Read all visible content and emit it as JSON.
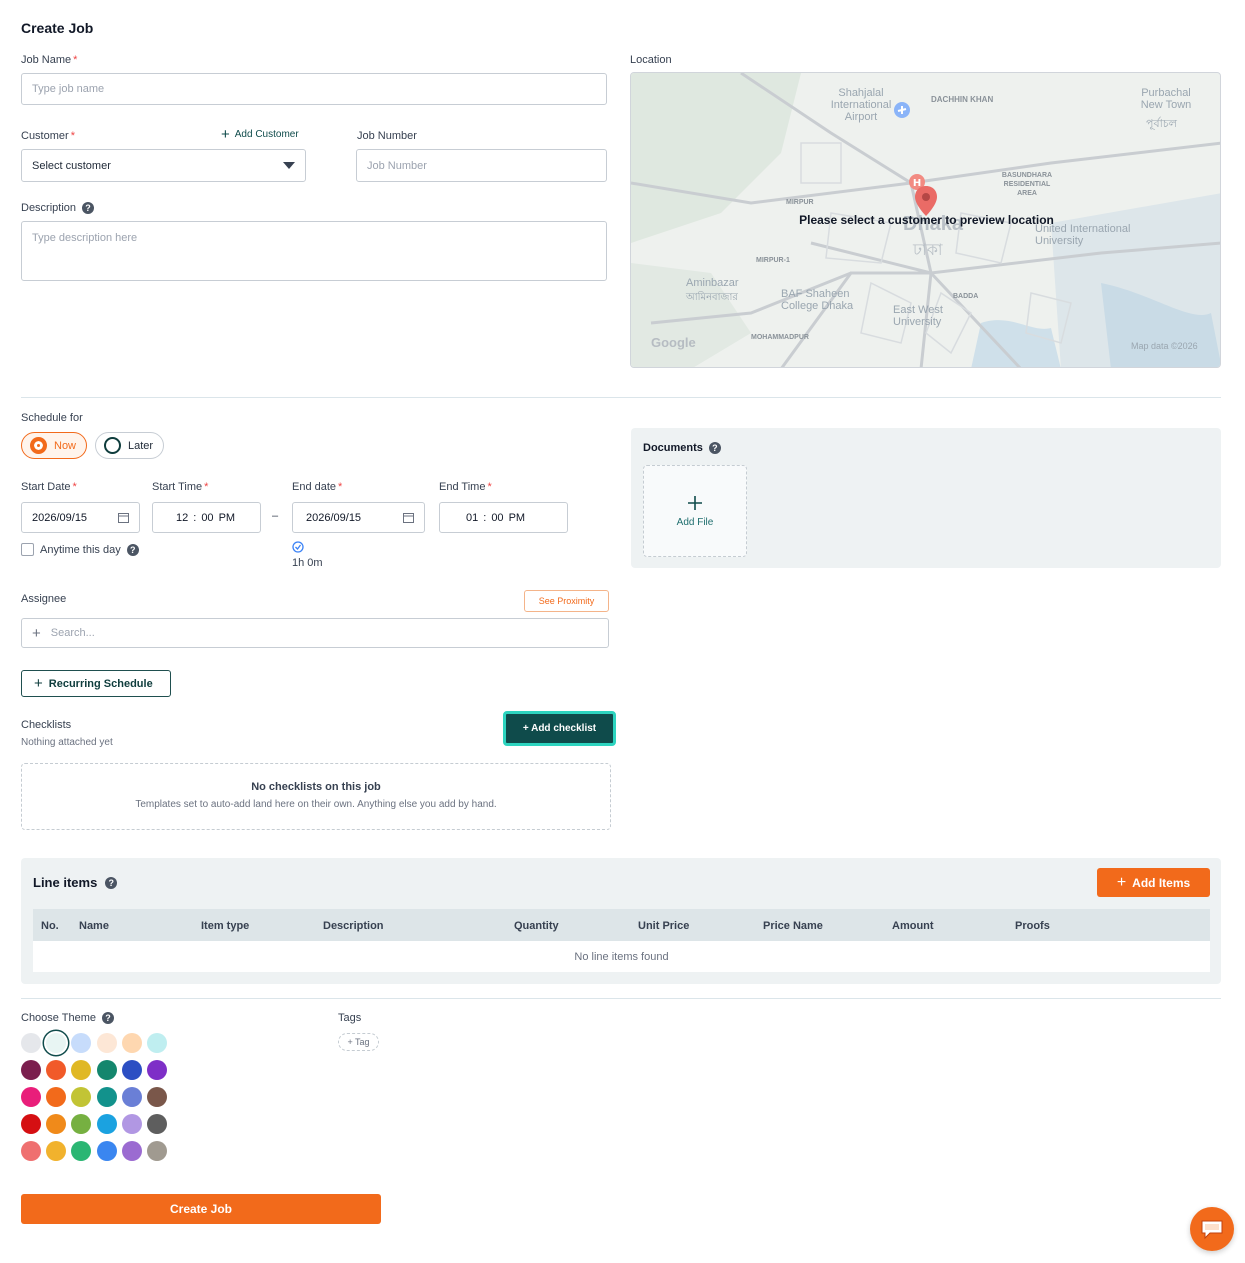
{
  "page": {
    "title": "Create Job"
  },
  "job_name": {
    "label": "Job Name",
    "placeholder": "Type job name"
  },
  "customer": {
    "label": "Customer",
    "add_label": "Add Customer",
    "selected": "Select customer"
  },
  "job_number": {
    "label": "Job Number",
    "placeholder": "Job Number"
  },
  "description": {
    "label": "Description",
    "placeholder": "Type description here"
  },
  "location": {
    "label": "Location",
    "overlay": "Please select a customer to preview location",
    "attribution": "Map data ©2026",
    "logo": "Google",
    "places": {
      "airport": "Shahjalal International Airport",
      "daschin": "DACHHIN KHAN",
      "purbachal": "Purbachal New Town",
      "purbachal_bn": "পূর্বাচল",
      "bashundhara": "BASUNDHARA RESIDENTIAL AREA",
      "mirpur": "MIRPUR",
      "mirpur1": "MIRPUR-1",
      "dhaka": "Dhaka",
      "dhaka_bn": "ঢাকা",
      "uiu": "United International University",
      "aminbazar": "Aminbazar",
      "aminbazar_bn": "আমিনবাজার",
      "baf": "BAF Shaheen College Dhaka",
      "eastwest": "East West University",
      "badda": "BADDA",
      "mohammadpur": "MOHAMMADPUR"
    }
  },
  "schedule": {
    "label": "Schedule for",
    "now": "Now",
    "later": "Later",
    "selected": "now"
  },
  "start_date": {
    "label": "Start Date",
    "value": "2026/09/15"
  },
  "start_time": {
    "label": "Start Time",
    "hour": "12",
    "minute": "00",
    "ampm": "PM"
  },
  "end_date": {
    "label": "End date",
    "value": "2026/09/15"
  },
  "end_time": {
    "label": "End Time",
    "hour": "01",
    "minute": "00",
    "ampm": "PM"
  },
  "range_sep": "–",
  "time_sep": ":",
  "anytime": {
    "label": "Anytime this day",
    "checked": false
  },
  "duration": "1h 0m",
  "documents": {
    "label": "Documents",
    "add_file": "Add File"
  },
  "assignee": {
    "label": "Assignee",
    "placeholder": "Search...",
    "proximity": "See Proximity"
  },
  "recurring": {
    "label": "Recurring Schedule"
  },
  "checklists": {
    "label": "Checklists",
    "status": "Nothing attached yet",
    "add": "+ Add checklist",
    "empty_title": "No checklists on this job",
    "empty_sub": "Templates set to auto-add land here on their own. Anything else you add by hand."
  },
  "line_items": {
    "title": "Line items",
    "add": "Add Items",
    "columns": [
      "No.",
      "Name",
      "Item type",
      "Description",
      "Quantity",
      "Unit Price",
      "Price Name",
      "Amount",
      "Proofs"
    ],
    "empty": "No line items found"
  },
  "theme": {
    "label": "Choose Theme",
    "selected_index": 1,
    "colors": [
      "#e5e7eb",
      "#e8f5f3",
      "#c7dcfb",
      "#fde7d6",
      "#fed7b0",
      "#bfeef0",
      "#7b1f4e",
      "#f15a29",
      "#e0b824",
      "#14866d",
      "#2c4fc3",
      "#7e2fc7",
      "#e91e7a",
      "#f26a1b",
      "#c2c435",
      "#12928c",
      "#6a7fd6",
      "#7a574a",
      "#d50f12",
      "#f08a1a",
      "#76b041",
      "#1ba2e0",
      "#b197e3",
      "#5e5e5e",
      "#ef7070",
      "#f1b22d",
      "#2bb673",
      "#3a86f0",
      "#9b6bd1",
      "#a09a90"
    ]
  },
  "tags": {
    "label": "Tags",
    "add": "+ Tag"
  },
  "submit": {
    "label": "Create Job"
  },
  "colors": {
    "accent": "#f26a1b",
    "primary": "#0f4b4b",
    "teal_highlight": "#2dd4bf"
  }
}
